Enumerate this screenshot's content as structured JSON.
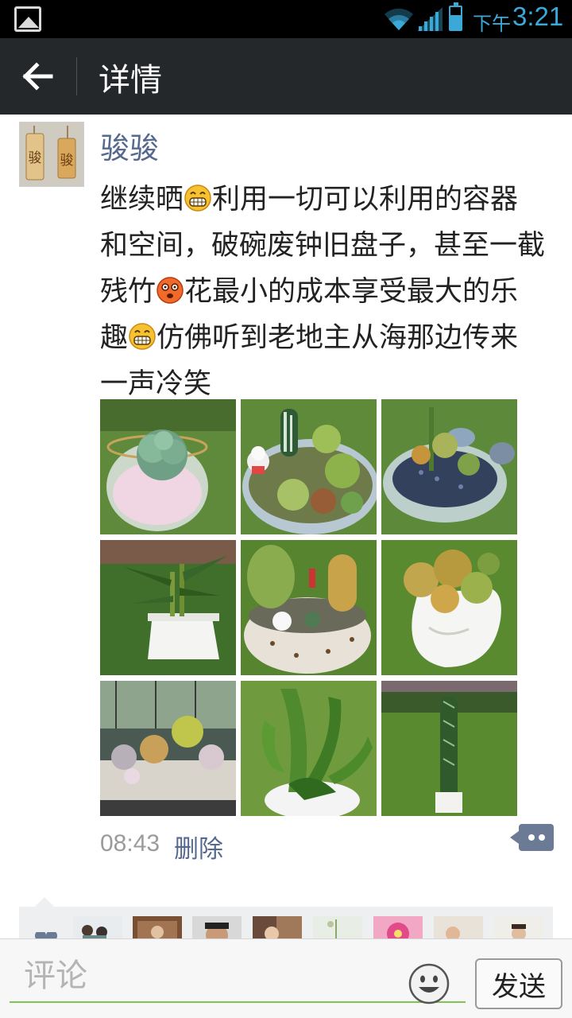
{
  "status_bar": {
    "ampm": "下午",
    "time": "3:21",
    "icons": [
      "gallery-notification-icon",
      "wifi-icon",
      "cell-signal-icon",
      "battery-icon"
    ]
  },
  "header": {
    "back_icon": "back-arrow-icon",
    "title": "详情"
  },
  "post": {
    "author": "骏骏",
    "avatar_text": "骏骏",
    "text_segments": [
      "继续晒",
      "利用一切可以利用的容器和空间，破碗废钟旧盘子，甚至一截残竹",
      "花最小的成本享受最大的乐趣",
      "仿佛听到老地主从海那边传来一声冷笑"
    ],
    "emojis": [
      "grin-emoji-icon",
      "dizzy-face-emoji-icon",
      "grin-emoji-icon"
    ],
    "photos": [
      "succulent-in-glass-bowl",
      "mixed-succulents-with-figurine",
      "succulents-in-glass-dish",
      "bamboo-in-white-pot",
      "cacti-in-dotted-bowl",
      "succulent-in-white-vase",
      "succulent-tray-on-table",
      "leafy-plant-in-bowl",
      "columnar-cactus-on-lawn"
    ],
    "time": "08:43",
    "delete_label": "删除",
    "comment_icon": "comment-bubble-icon"
  },
  "likes": {
    "icon": "heart-icon",
    "avatars": [
      "liker-avatar-1",
      "liker-avatar-2",
      "liker-avatar-3",
      "liker-avatar-4",
      "liker-avatar-5",
      "liker-avatar-6",
      "liker-avatar-7",
      "liker-avatar-8"
    ]
  },
  "comment_bar": {
    "placeholder": "评论",
    "emoji_icon": "smiley-face-icon",
    "send_label": "发送"
  },
  "colors": {
    "status_bar_bg": "#000000",
    "status_accent": "#3aa9d8",
    "title_bar_bg": "#24282b",
    "link": "#55698f",
    "input_underline": "#7fc453",
    "comment_button": "#6c7b95"
  }
}
